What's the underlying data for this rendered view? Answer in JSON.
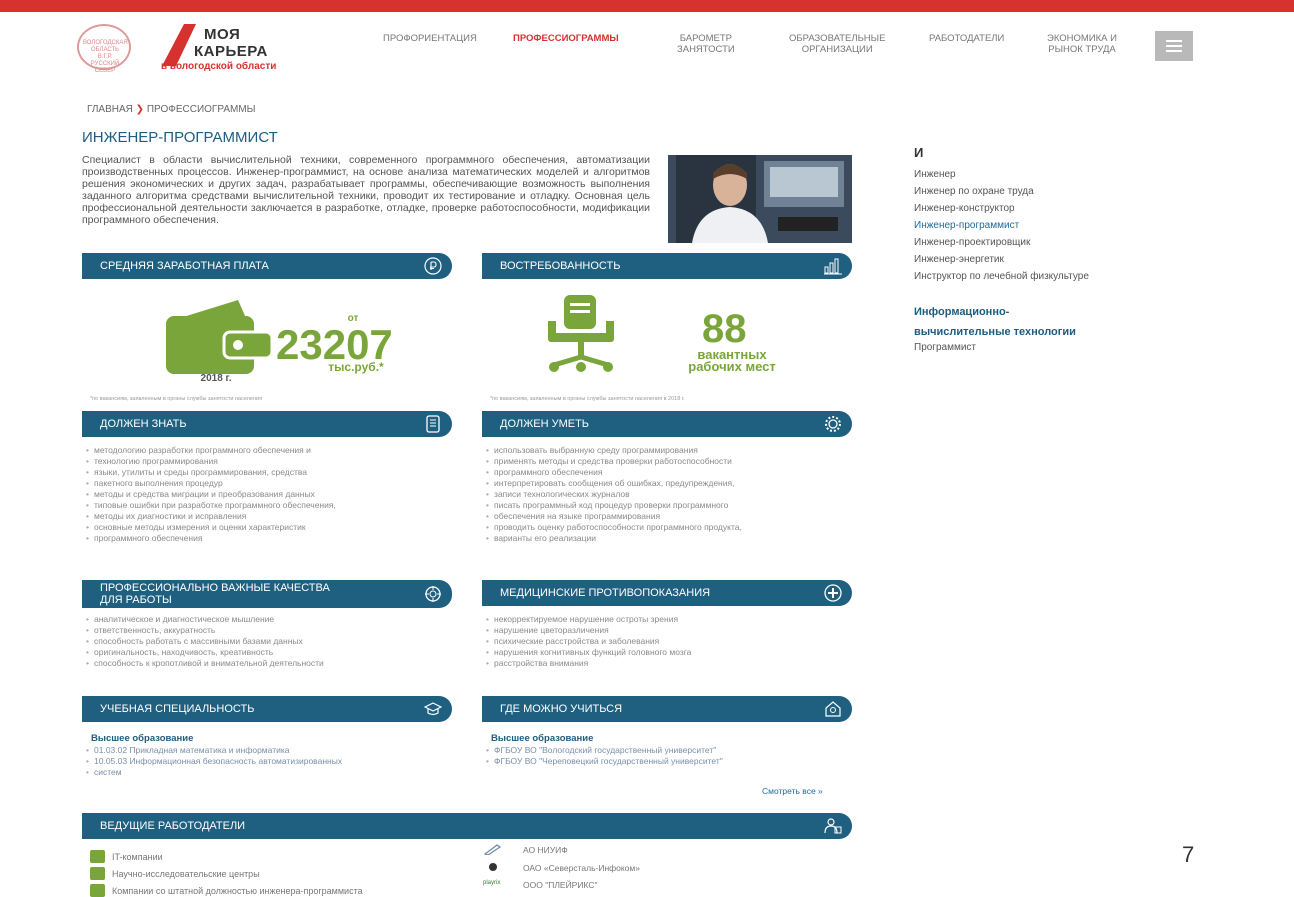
{
  "header": {
    "seal_text": "ВОЛОГОДСКАЯ ОБЛАСТЬ В.Г.Р. РУССКИЙ СЕВЕР",
    "logo_line1": "МОЯ",
    "logo_line2": "КАРЬЕРА",
    "logo_line3": "в вологодской области",
    "nav": [
      {
        "label_l1": "ПРОФОРИЕНТАЦИЯ",
        "label_l2": ""
      },
      {
        "label_l1": "ПРОФЕССИОГРАММЫ",
        "label_l2": ""
      },
      {
        "label_l1": "БАРОМЕТР",
        "label_l2": "ЗАНЯТОСТИ"
      },
      {
        "label_l1": "ОБРАЗОВАТЕЛЬНЫЕ",
        "label_l2": "ОРГАНИЗАЦИИ"
      },
      {
        "label_l1": "РАБОТОДАТЕЛИ",
        "label_l2": ""
      },
      {
        "label_l1": "ЭКОНОМИКА И",
        "label_l2": "РЫНОК ТРУДА"
      }
    ],
    "brand_color": "#d6322f"
  },
  "breadcrumb": {
    "home": "ГЛАВНАЯ",
    "sep": "❯",
    "current": "ПРОФЕССИОГРАММЫ"
  },
  "profession": {
    "title": "ИНЖЕНЕР-ПРОГРАММИСТ",
    "description": "Специалист в области вычислительной техники, современного программного обеспечения, автоматизации производственных процессов. Инженер-программист, на основе анализа математических моделей и алгоритмов решения экономических и других задач, разрабатывает программы, обеспечивающие возможность выполнения заданного алгоритма средствами вычислительной техники, проводит их тестирование и отладку. Основная цель профессиональной деятельности заключается в разработке, отладке, проверке работоспособности, модификации программного обеспечения."
  },
  "salary": {
    "title": "СРЕДНЯЯ ЗАРАБОТНАЯ ПЛАТА",
    "prefix": "от",
    "value": "23207",
    "unit": "тыс.руб.*",
    "year": "2018 г.",
    "note": "*по вакансиям, заявленным в органы службы занятости населения"
  },
  "demand": {
    "title": "ВОСТРЕБОВАННОСТЬ",
    "value": "88",
    "label_l1": "вакантных",
    "label_l2": "рабочих мест",
    "note": "*по вакансиям, заявленным в органы службы занятости населения в 2018 г."
  },
  "know": {
    "title": "ДОЛЖЕН ЗНАТЬ",
    "items": [
      "методологию разработки программного обеспечения и",
      "технологию программирования",
      "языки, утилиты и среды программирования, средства",
      "пакетного выполнения процедур",
      "методы и средства миграции и преобразования данных",
      "типовые ошибки при разработке программного обеспечения,",
      "методы их диагностики и исправления",
      "основные методы измерения и оценки характеристик",
      "программного обеспечения"
    ]
  },
  "skills": {
    "title": "ДОЛЖЕН УМЕТЬ",
    "items": [
      "использовать выбранную среду программирования",
      "применять методы и средства проверки работоспособности",
      "программного обеспечения",
      "интерпретировать сообщения об ошибках, предупреждения,",
      "записи технологических журналов",
      "писать программный код процедур проверки программного",
      "обеспечения на языке программирования",
      "проводить оценку работоспособности программного продукта,",
      "варианты его реализации"
    ]
  },
  "qualities": {
    "title_l1": "ПРОФЕССИОНАЛЬНО ВАЖНЫЕ КАЧЕСТВА",
    "title_l2": "ДЛЯ РАБОТЫ",
    "items": [
      "аналитическое и диагностическое мышление",
      "ответственность, аккуратность",
      "способность работать с массивными базами данных",
      "оригинальность, находчивость, креативность",
      "способность к кропотливой и внимательной деятельности"
    ]
  },
  "medical": {
    "title": "МЕДИЦИНСКИЕ ПРОТИВОПОКАЗАНИЯ",
    "items": [
      "некорректируемое нарушение остроты зрения",
      "нарушение цветоразличения",
      "психические расстройства и заболевания",
      "нарушения когнитивных функций головного мозга",
      "расстройства внимания"
    ]
  },
  "specialty": {
    "title": "УЧЕБНАЯ СПЕЦИАЛЬНОСТЬ",
    "subhead": "Высшее образование",
    "items": [
      "01.03.02 Прикладная математика и информатика",
      "10.05.03 Информационная безопасность автоматизированных",
      "систем"
    ]
  },
  "study": {
    "title": "ГДЕ МОЖНО УЧИТЬСЯ",
    "subhead": "Высшее образование",
    "items": [
      "ФГБОУ ВО \"Вологодский государственный университет\"",
      "ФГБОУ ВО \"Череповецкий государственный университет\""
    ],
    "more": "Смотреть все »"
  },
  "employers": {
    "title": "ВЕДУЩИЕ РАБОТОДАТЕЛИ",
    "types": [
      "IT-компании",
      "Научно-исследовательские центры",
      "Компании со штатной должностью инженера-программиста"
    ],
    "companies": [
      {
        "name": "АО НИУИФ",
        "logo": "pen-icon"
      },
      {
        "name": "ОАО «Северсталь-Инфоком»",
        "logo": "severstal-logo"
      },
      {
        "name": "ООО \"ПЛЕЙРИКС\"",
        "logo": "playrix"
      }
    ]
  },
  "sidebar": {
    "letter": "И",
    "items": [
      "Инженер",
      "Инженер по охране труда",
      "Инженер-конструктор",
      "Инженер-программист",
      "Инженер-проектировщик",
      "Инженер-энергетик",
      "Инструктор по лечебной физкультуре"
    ],
    "category_l1": "Информационно-",
    "category_l2": "вычислительные технологии",
    "category_item": "Программист"
  },
  "page_number": "7",
  "colors": {
    "bar": "#1f5f80",
    "accent_green": "#7aa53a",
    "title_blue": "#1e5c80"
  }
}
